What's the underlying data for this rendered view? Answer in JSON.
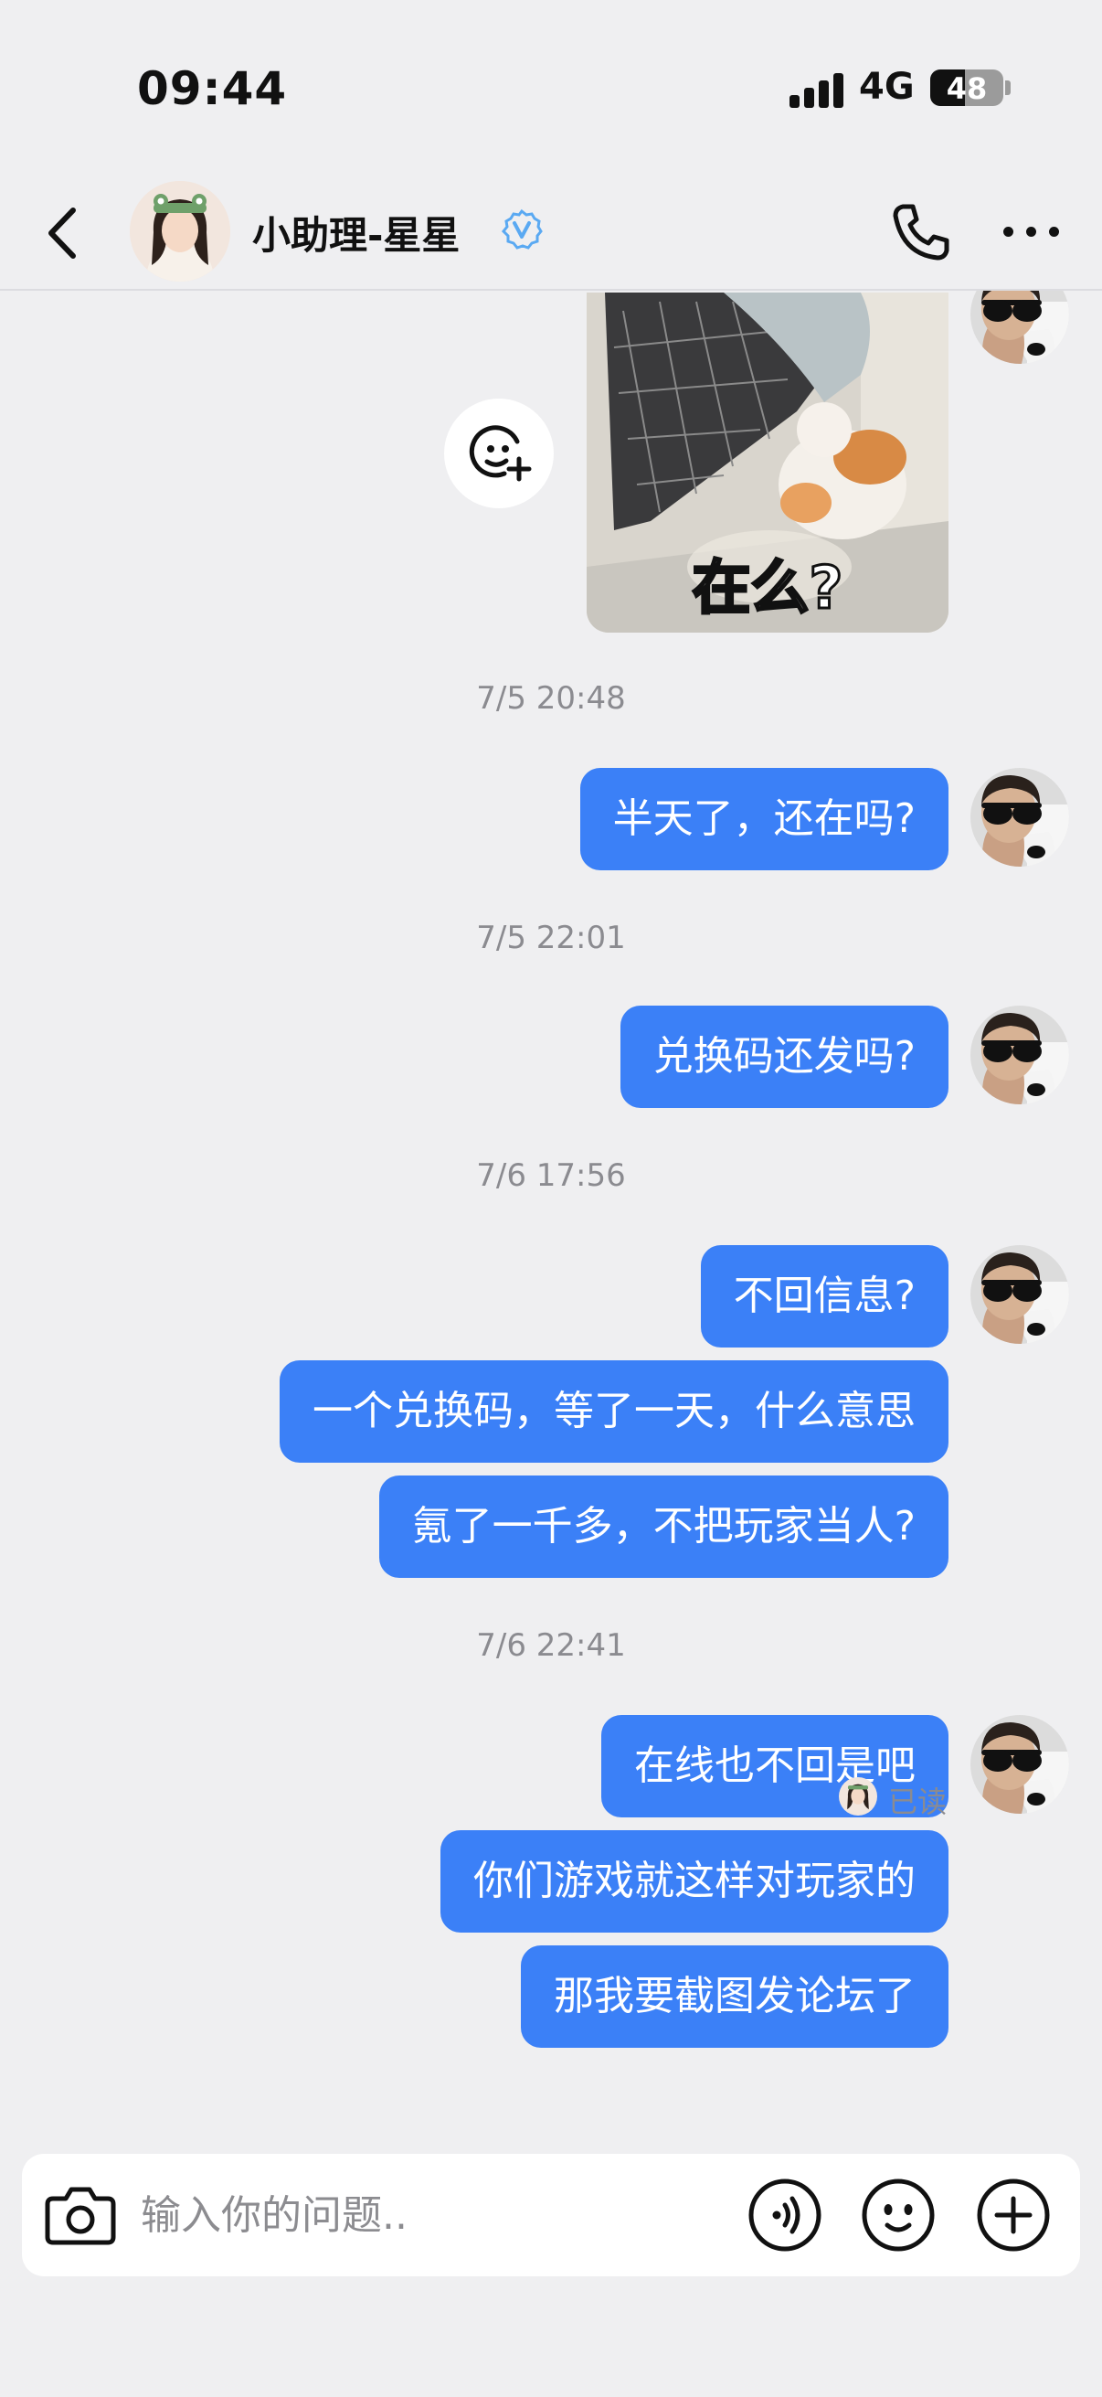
{
  "status_bar": {
    "time": "09:44",
    "network": "4G",
    "battery": "48",
    "battery_level": 0.48
  },
  "header": {
    "title": "小助理-星星"
  },
  "chat": {
    "sticker_caption": "在么?",
    "timestamps": [
      "7/5 20:48",
      "7/5 22:01",
      "7/6 17:56",
      "7/6 22:41"
    ],
    "messages": [
      "半天了，还在吗?",
      "兑换码还发吗?",
      "不回信息?",
      "一个兑换码，等了一天，什么意思",
      "氪了一千多，不把玩家当人?",
      "在线也不回是吧",
      "你们游戏就这样对玩家的",
      "那我要截图发论坛了"
    ],
    "read_status": "已读"
  },
  "input": {
    "placeholder": "输入你的问题.."
  },
  "colors": {
    "accent": "#3b80f7",
    "background": "#efeff1",
    "verified": "#5aa9f2"
  }
}
